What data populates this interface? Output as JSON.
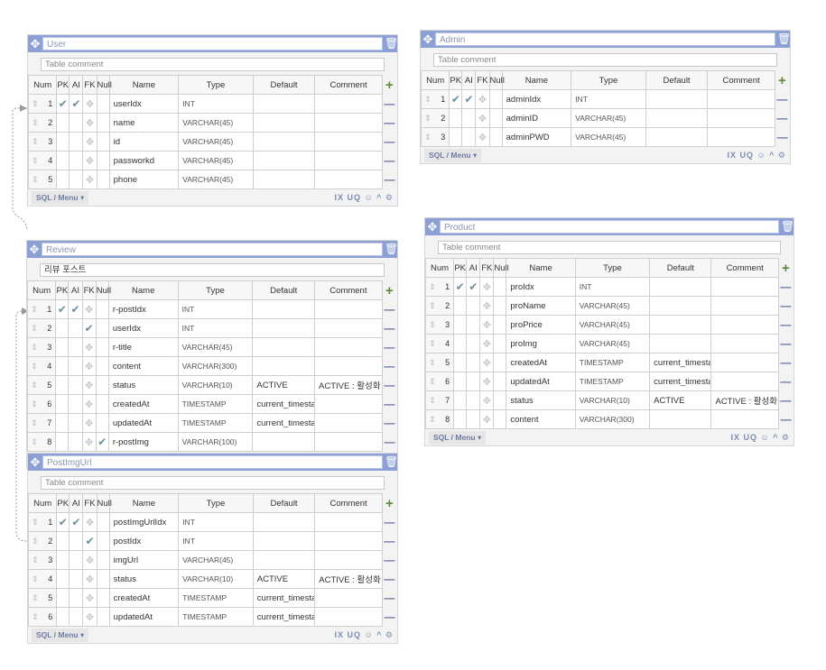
{
  "columns": {
    "num": "Num",
    "pk": "PK",
    "ai": "AI",
    "fk": "FK",
    "null": "Null",
    "name": "Name",
    "type": "Type",
    "default": "Default",
    "comment": "Comment"
  },
  "icons": {
    "move": "move-icon",
    "trash": "trash-icon",
    "add": "plus-icon",
    "remove": "minus-icon",
    "settings": "gear-icon",
    "check": "checkmark-icon",
    "drag": "drag-handle-icon",
    "fk": "fk-icon"
  },
  "footer": {
    "sql_menu": "SQL / Menu ▾",
    "tools": "IX UQ ☺ ^ ⚙"
  },
  "tables": {
    "user": {
      "title": "User",
      "comment_placeholder": "Table comment",
      "comment": "",
      "rows": [
        {
          "num": "1",
          "pk": true,
          "ai": true,
          "fk": false,
          "null": false,
          "name": "userIdx",
          "type": "INT",
          "default": "",
          "comment": ""
        },
        {
          "num": "2",
          "pk": false,
          "ai": false,
          "fk": false,
          "null": false,
          "name": "name",
          "type": "VARCHAR(45)",
          "default": "",
          "comment": ""
        },
        {
          "num": "3",
          "pk": false,
          "ai": false,
          "fk": false,
          "null": false,
          "name": "id",
          "type": "VARCHAR(45)",
          "default": "",
          "comment": ""
        },
        {
          "num": "4",
          "pk": false,
          "ai": false,
          "fk": false,
          "null": false,
          "name": "passworkd",
          "type": "VARCHAR(45)",
          "default": "",
          "comment": ""
        },
        {
          "num": "5",
          "pk": false,
          "ai": false,
          "fk": false,
          "null": false,
          "name": "phone",
          "type": "VARCHAR(45)",
          "default": "",
          "comment": ""
        }
      ]
    },
    "admin": {
      "title": "Admin",
      "comment_placeholder": "Table comment",
      "comment": "",
      "rows": [
        {
          "num": "1",
          "pk": true,
          "ai": true,
          "fk": false,
          "null": false,
          "name": "adminIdx",
          "type": "INT",
          "default": "",
          "comment": ""
        },
        {
          "num": "2",
          "pk": false,
          "ai": false,
          "fk": false,
          "null": false,
          "name": "adminID",
          "type": "VARCHAR(45)",
          "default": "",
          "comment": ""
        },
        {
          "num": "3",
          "pk": false,
          "ai": false,
          "fk": false,
          "null": false,
          "name": "adminPWD",
          "type": "VARCHAR(45)",
          "default": "",
          "comment": ""
        }
      ]
    },
    "review": {
      "title": "Review",
      "comment_placeholder": "Table comment",
      "comment": "리뷰 포스트",
      "rows": [
        {
          "num": "1",
          "pk": true,
          "ai": true,
          "fk": false,
          "null": false,
          "name": "r-postIdx",
          "type": "INT",
          "default": "",
          "comment": ""
        },
        {
          "num": "2",
          "pk": false,
          "ai": false,
          "fk": true,
          "null": false,
          "name": "userIdx",
          "type": "INT",
          "default": "",
          "comment": ""
        },
        {
          "num": "3",
          "pk": false,
          "ai": false,
          "fk": false,
          "null": false,
          "name": "r-title",
          "type": "VARCHAR(45)",
          "default": "",
          "comment": ""
        },
        {
          "num": "4",
          "pk": false,
          "ai": false,
          "fk": false,
          "null": false,
          "name": "content",
          "type": "VARCHAR(300)",
          "default": "",
          "comment": ""
        },
        {
          "num": "5",
          "pk": false,
          "ai": false,
          "fk": false,
          "null": false,
          "name": "status",
          "type": "VARCHAR(10)",
          "default": "ACTIVE",
          "comment": "ACTIVE : 활성화"
        },
        {
          "num": "6",
          "pk": false,
          "ai": false,
          "fk": false,
          "null": false,
          "name": "createdAt",
          "type": "TIMESTAMP",
          "default": "current_timestamp",
          "comment": ""
        },
        {
          "num": "7",
          "pk": false,
          "ai": false,
          "fk": false,
          "null": false,
          "name": "updatedAt",
          "type": "TIMESTAMP",
          "default": "current_timestamp",
          "comment": ""
        },
        {
          "num": "8",
          "pk": false,
          "ai": false,
          "fk": false,
          "null": true,
          "name": "r-postImg",
          "type": "VARCHAR(100)",
          "default": "",
          "comment": ""
        }
      ]
    },
    "postimgurl": {
      "title": "PostImgUrl",
      "comment_placeholder": "Table comment",
      "comment": "",
      "rows": [
        {
          "num": "1",
          "pk": true,
          "ai": true,
          "fk": false,
          "null": false,
          "name": "postImgUrlIdx",
          "type": "INT",
          "default": "",
          "comment": ""
        },
        {
          "num": "2",
          "pk": false,
          "ai": false,
          "fk": true,
          "null": false,
          "name": "postIdx",
          "type": "INT",
          "default": "",
          "comment": ""
        },
        {
          "num": "3",
          "pk": false,
          "ai": false,
          "fk": false,
          "null": false,
          "name": "imgUrl",
          "type": "VARCHAR(45)",
          "default": "",
          "comment": ""
        },
        {
          "num": "4",
          "pk": false,
          "ai": false,
          "fk": false,
          "null": false,
          "name": "status",
          "type": "VARCHAR(10)",
          "default": "ACTIVE",
          "comment": "ACTIVE : 활성화"
        },
        {
          "num": "5",
          "pk": false,
          "ai": false,
          "fk": false,
          "null": false,
          "name": "createdAt",
          "type": "TIMESTAMP",
          "default": "current_timestamp",
          "comment": ""
        },
        {
          "num": "6",
          "pk": false,
          "ai": false,
          "fk": false,
          "null": false,
          "name": "updatedAt",
          "type": "TIMESTAMP",
          "default": "current_timestamp",
          "comment": ""
        }
      ]
    },
    "product": {
      "title": "Product",
      "comment_placeholder": "Table comment",
      "comment": "",
      "rows": [
        {
          "num": "1",
          "pk": true,
          "ai": true,
          "fk": false,
          "null": false,
          "name": "proIdx",
          "type": "INT",
          "default": "",
          "comment": ""
        },
        {
          "num": "2",
          "pk": false,
          "ai": false,
          "fk": false,
          "null": false,
          "name": "proName",
          "type": "VARCHAR(45)",
          "default": "",
          "comment": ""
        },
        {
          "num": "3",
          "pk": false,
          "ai": false,
          "fk": false,
          "null": false,
          "name": "proPrice",
          "type": "VARCHAR(45)",
          "default": "",
          "comment": ""
        },
        {
          "num": "4",
          "pk": false,
          "ai": false,
          "fk": false,
          "null": false,
          "name": "proImg",
          "type": "VARCHAR(45)",
          "default": "",
          "comment": ""
        },
        {
          "num": "5",
          "pk": false,
          "ai": false,
          "fk": false,
          "null": false,
          "name": "createdAt",
          "type": "TIMESTAMP",
          "default": "current_timestamp",
          "comment": ""
        },
        {
          "num": "6",
          "pk": false,
          "ai": false,
          "fk": false,
          "null": false,
          "name": "updatedAt",
          "type": "TIMESTAMP",
          "default": "current_timestamp",
          "comment": ""
        },
        {
          "num": "7",
          "pk": false,
          "ai": false,
          "fk": false,
          "null": false,
          "name": "status",
          "type": "VARCHAR(10)",
          "default": "ACTIVE",
          "comment": "ACTIVE : 활성화"
        },
        {
          "num": "8",
          "pk": false,
          "ai": false,
          "fk": false,
          "null": false,
          "name": "content",
          "type": "VARCHAR(300)",
          "default": "",
          "comment": ""
        }
      ]
    }
  }
}
